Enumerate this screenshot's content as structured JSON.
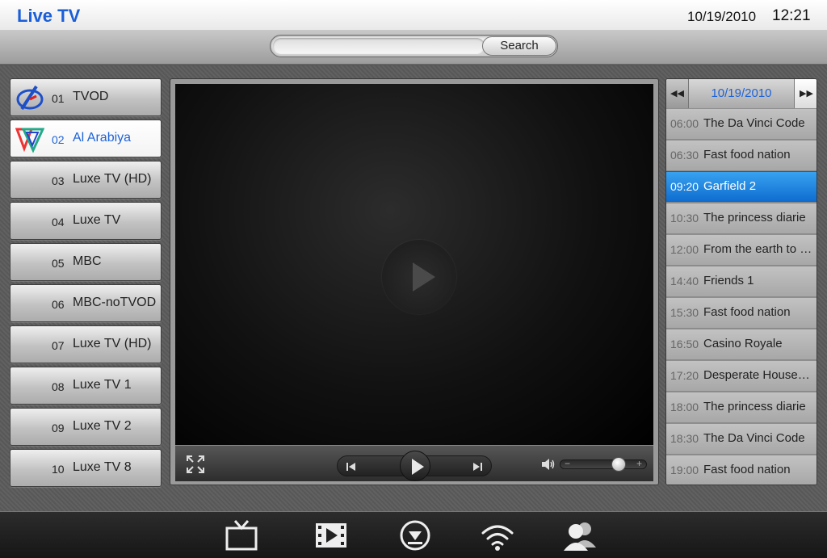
{
  "header": {
    "title": "Live TV",
    "date": "10/19/2010",
    "time": "12:21"
  },
  "search": {
    "placeholder": "",
    "value": "",
    "button_label": "Search"
  },
  "channels": [
    {
      "number": "01",
      "name": "TVOD",
      "logo": "tvod-logo-icon",
      "active": false
    },
    {
      "number": "02",
      "name": "Al Arabiya",
      "logo": "al-arabiya-logo-icon",
      "active": true
    },
    {
      "number": "03",
      "name": "Luxe TV (HD)",
      "logo": "",
      "active": false
    },
    {
      "number": "04",
      "name": "Luxe TV",
      "logo": "",
      "active": false
    },
    {
      "number": "05",
      "name": "MBC",
      "logo": "",
      "active": false
    },
    {
      "number": "06",
      "name": "MBC-noTVOD",
      "logo": "",
      "active": false
    },
    {
      "number": "07",
      "name": "Luxe TV (HD)",
      "logo": "",
      "active": false
    },
    {
      "number": "08",
      "name": "Luxe TV 1",
      "logo": "",
      "active": false
    },
    {
      "number": "09",
      "name": "Luxe TV 2",
      "logo": "",
      "active": false
    },
    {
      "number": "10",
      "name": "Luxe TV 8",
      "logo": "",
      "active": false
    }
  ],
  "player": {
    "volume_level": 0.7,
    "icons": [
      "play-icon",
      "fullscreen-icon",
      "previous-icon",
      "next-icon",
      "volume-icon"
    ]
  },
  "epg": {
    "date": "10/19/2010",
    "prev_icon": "rewind-icon",
    "next_icon": "fast-forward-icon",
    "programs": [
      {
        "time": "06:00",
        "title": "The Da Vinci Code",
        "selected": false
      },
      {
        "time": "06:30",
        "title": "Fast food nation",
        "selected": false
      },
      {
        "time": "09:20",
        "title": "Garfield 2",
        "selected": true
      },
      {
        "time": "10:30",
        "title": "The princess diarie",
        "selected": false
      },
      {
        "time": "12:00",
        "title": "From the earth to the moon",
        "selected": false
      },
      {
        "time": "14:40",
        "title": "Friends 1",
        "selected": false
      },
      {
        "time": "15:30",
        "title": "Fast food nation",
        "selected": false
      },
      {
        "time": "16:50",
        "title": "Casino Royale",
        "selected": false
      },
      {
        "time": "17:20",
        "title": "Desperate Housewives",
        "selected": false
      },
      {
        "time": "18:00",
        "title": "The princess diarie",
        "selected": false
      },
      {
        "time": "18:30",
        "title": "The Da Vinci Code",
        "selected": false
      },
      {
        "time": "19:00",
        "title": "Fast food nation",
        "selected": false
      }
    ]
  },
  "dock": {
    "items": [
      "live-tv-icon",
      "movies-icon",
      "download-icon",
      "wifi-icon",
      "users-icon"
    ]
  },
  "colors": {
    "accent": "#1d63d9",
    "selected_row": "#1b7fe0"
  }
}
